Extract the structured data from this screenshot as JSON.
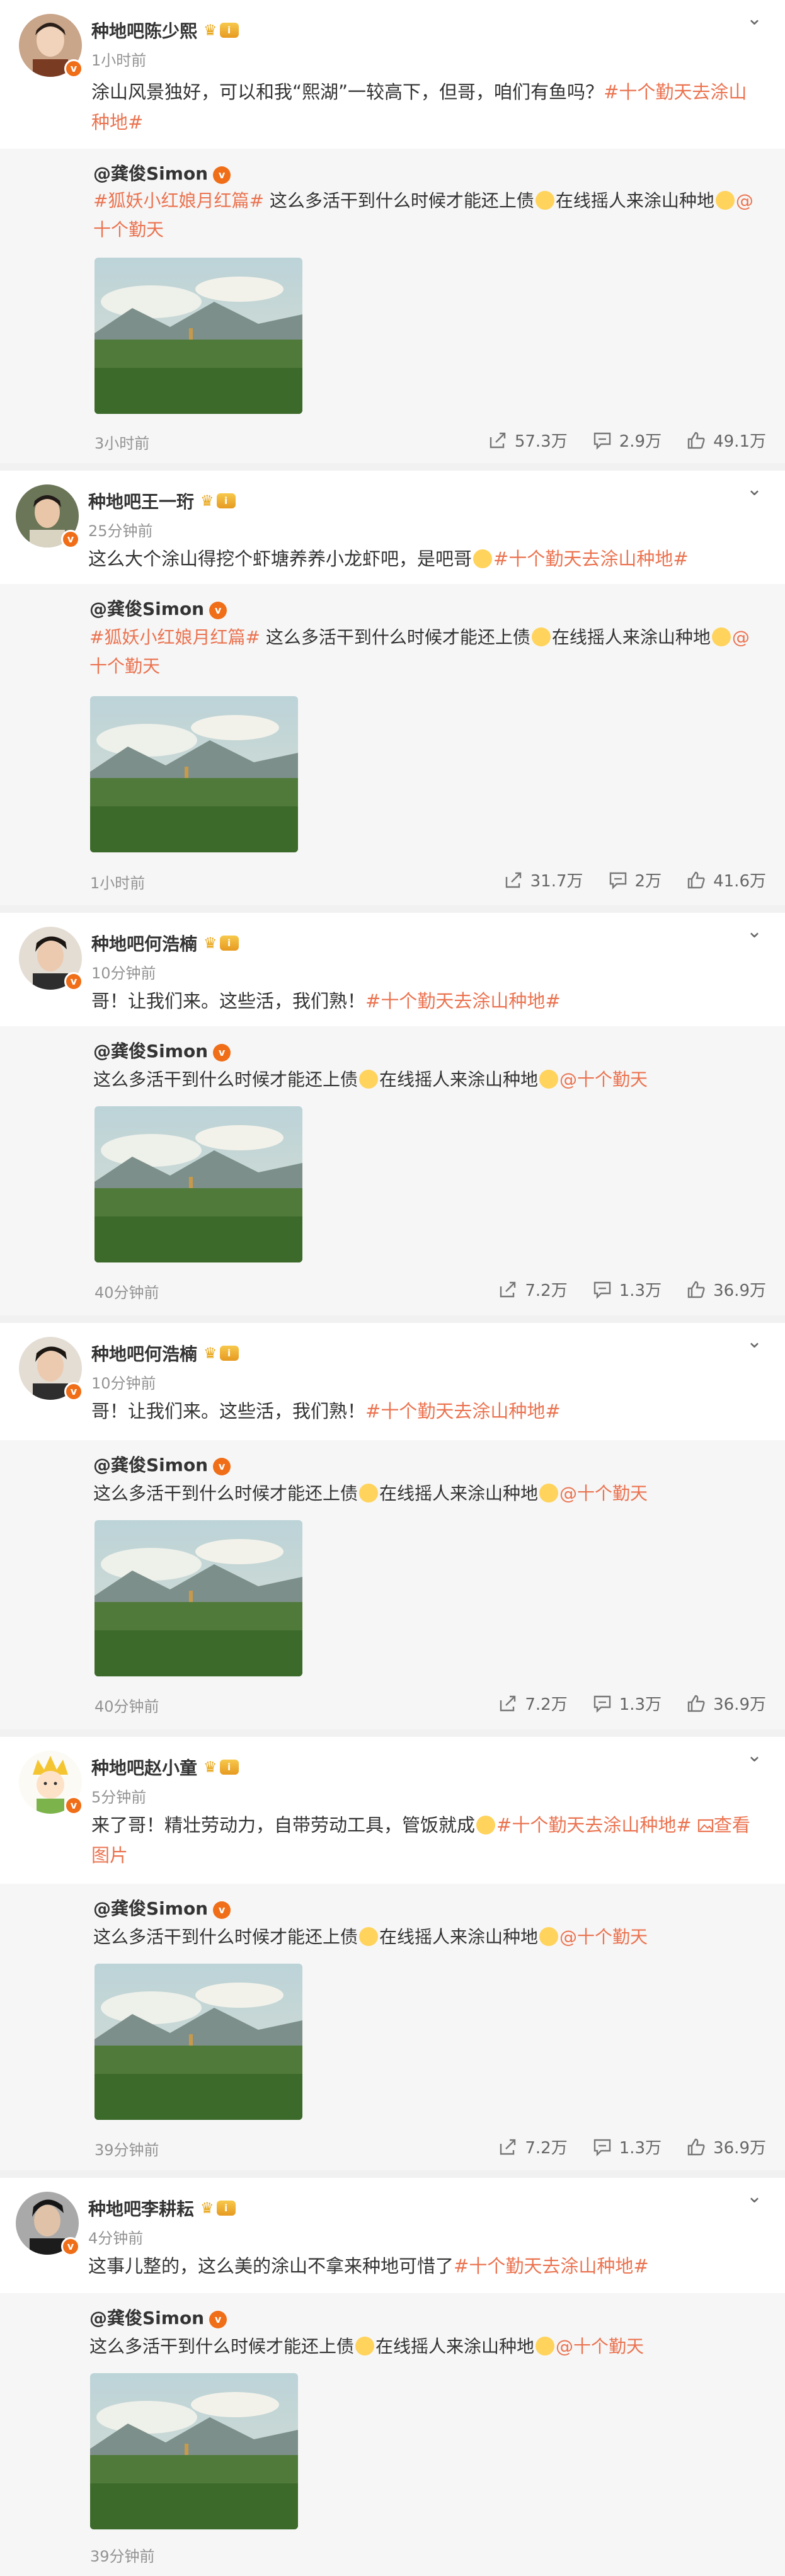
{
  "colors": {
    "accent": "#eb7350",
    "verify_badge": "#f06e18",
    "secondary_text": "#939393"
  },
  "icons": {
    "verify": "v",
    "crown": "crown-icon",
    "level": "level-badge-icon",
    "chevron": "chevron-down-icon",
    "share": "share-icon",
    "comment": "comment-icon",
    "like": "like-icon",
    "image": "image-icon"
  },
  "common": {
    "level_label": "i",
    "verify_label": "v",
    "crown_glyph": "♛",
    "chevron_glyph": "⌄",
    "repost_author": "@龚俊Simon"
  },
  "posts": [
    {
      "author": "种地吧陈少熙",
      "time": "1小时前",
      "text_plain": "涂山风景独好，可以和我“熙湖”一较高下，但哥，咱们有鱼吗？",
      "text_tag": "#十个勤天去涂山种地#",
      "repost_tag": "#狐妖小红娘月红篇#",
      "repost_text_a": " 这么多活干到什么时候才能还上债",
      "repost_text_b": "在线摇人来涂山种地",
      "repost_mention": "@十个勤天",
      "repost_time": "3小时前",
      "shares": "57.3万",
      "comments": "2.9万",
      "likes": "49.1万"
    },
    {
      "author": "种地吧王一珩",
      "time": "25分钟前",
      "text_plain": "这么大个涂山得挖个虾塘养养小龙虾吧，是吧哥",
      "text_tag": "#十个勤天去涂山种地#",
      "repost_tag": "#狐妖小红娘月红篇#",
      "repost_text_a": " 这么多活干到什么时候才能还上债",
      "repost_text_b": "在线摇人来涂山种地",
      "repost_mention": "@十个勤天",
      "repost_time": "1小时前",
      "shares": "31.7万",
      "comments": "2万",
      "likes": "41.6万"
    },
    {
      "author": "种地吧何浩楠",
      "time": "10分钟前",
      "text_plain": "哥！让我们来。这些活，我们熟！",
      "text_tag": "#十个勤天去涂山种地#",
      "repost_text_a": "这么多活干到什么时候才能还上债",
      "repost_text_b": "在线摇人来涂山种地",
      "repost_mention": "@十个勤天",
      "repost_time": "40分钟前",
      "shares": "7.2万",
      "comments": "1.3万",
      "likes": "36.9万"
    },
    {
      "author": "种地吧何浩楠",
      "time": "10分钟前",
      "text_plain": "哥！让我们来。这些活，我们熟！",
      "text_tag": "#十个勤天去涂山种地#",
      "repost_text_a": "这么多活干到什么时候才能还上债",
      "repost_text_b": "在线摇人来涂山种地",
      "repost_mention": "@十个勤天",
      "repost_time": "40分钟前",
      "shares": "7.2万",
      "comments": "1.3万",
      "likes": "36.9万"
    },
    {
      "author": "种地吧赵小童",
      "time": "5分钟前",
      "text_plain": "来了哥！精壮劳动力，自带劳动工具，管饭就成",
      "text_tag": "#十个勤天去涂山种地#",
      "view_image": "查看图片",
      "repost_text_a": "这么多活干到什么时候才能还上债",
      "repost_text_b": "在线摇人来涂山种地",
      "repost_mention": "@十个勤天",
      "repost_time": "39分钟前",
      "shares": "7.2万",
      "comments": "1.3万",
      "likes": "36.9万"
    },
    {
      "author": "种地吧李耕耘",
      "time": "4分钟前",
      "text_plain": "这事儿整的，这么美的涂山不拿来种地可惜了",
      "text_tag": "#十个勤天去涂山种地#",
      "repost_text_a": "这么多活干到什么时候才能还上债",
      "repost_text_b": "在线摇人来涂山种地",
      "repost_mention": "@十个勤天",
      "repost_time": "39分钟前"
    }
  ]
}
